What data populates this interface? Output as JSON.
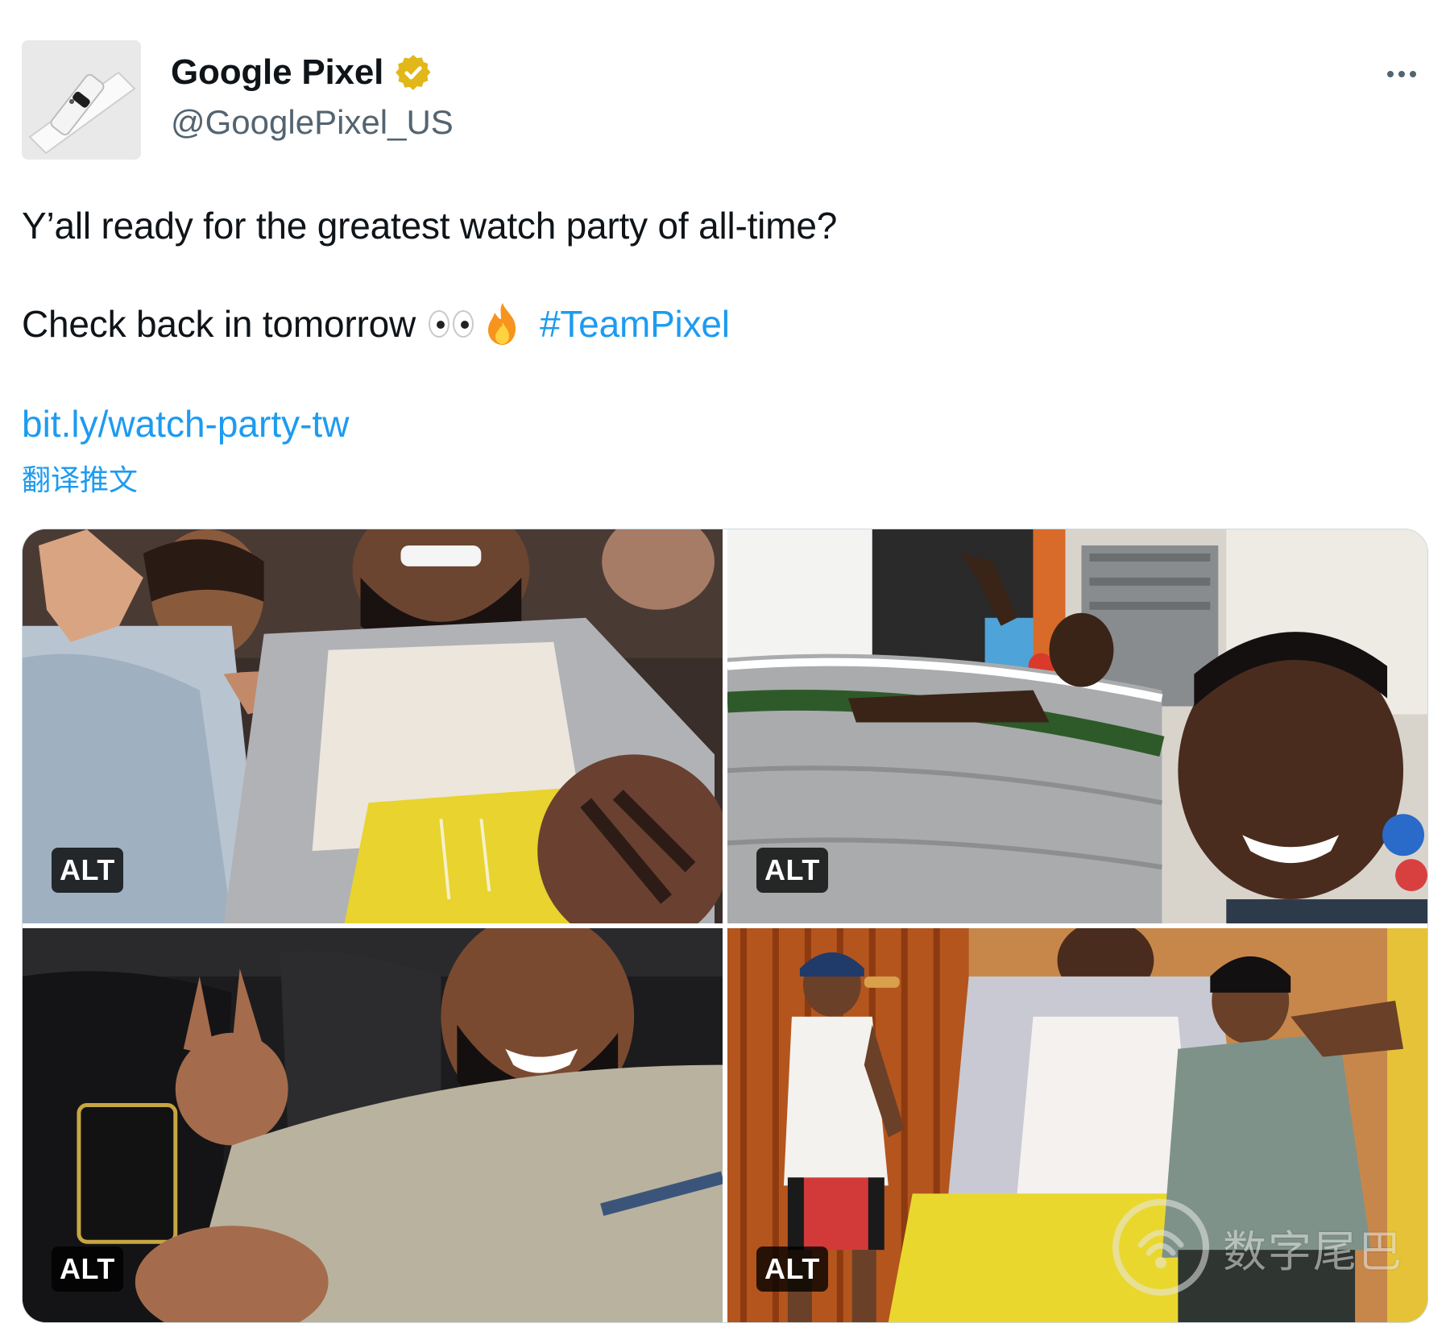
{
  "author": {
    "display_name": "Google Pixel",
    "handle": "@GooglePixel_US",
    "verified_badge_icon": "verified-badge-icon",
    "verified_color": "#e2b719"
  },
  "tweet": {
    "line1": "Y’all ready for the greatest watch party of all-time?",
    "line2_text": "Check back in tomorrow",
    "hashtag": "#TeamPixel",
    "link": "bit.ly/watch-party-tw",
    "translate_label": "翻译推文"
  },
  "media": {
    "items": [
      {
        "alt_label": "ALT"
      },
      {
        "alt_label": "ALT"
      },
      {
        "alt_label": "ALT"
      },
      {
        "alt_label": "ALT"
      }
    ]
  },
  "watermark": {
    "text": "数字尾巴"
  },
  "colors": {
    "link": "#1d9bf0",
    "secondary_text": "#536471",
    "primary_text": "#0f1419"
  }
}
